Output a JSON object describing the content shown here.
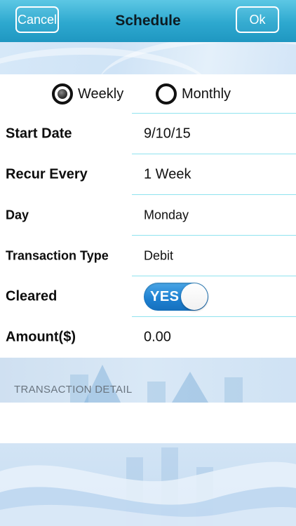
{
  "nav": {
    "title": "Schedule",
    "cancel_label": "Cancel",
    "ok_label": "Ok"
  },
  "frequency": {
    "options": [
      {
        "label": "Weekly",
        "selected": true
      },
      {
        "label": "Monthly",
        "selected": false
      }
    ]
  },
  "fields": {
    "start_date": {
      "label": "Start Date",
      "value": "9/10/15"
    },
    "recur_every": {
      "label": "Recur Every",
      "value": "1 Week"
    },
    "day": {
      "label": "Day",
      "value": "Monday"
    },
    "transaction_type": {
      "label": "Transaction Type",
      "value": "Debit"
    },
    "cleared": {
      "label": "Cleared",
      "toggle_text": "YES",
      "on": true
    },
    "amount": {
      "label": "Amount($)",
      "value": "0.00"
    }
  },
  "detail": {
    "section_header": "TRANSACTION DETAIL",
    "value": ""
  },
  "colors": {
    "nav_bar": "#2da8cf",
    "divider": "#8fe3ef",
    "toggle_on": "#1d7fd0",
    "background_art": "#cfe0f1"
  },
  "icons": {
    "radio_selected": "radio-selected-icon",
    "radio_unselected": "radio-unselected-icon"
  }
}
